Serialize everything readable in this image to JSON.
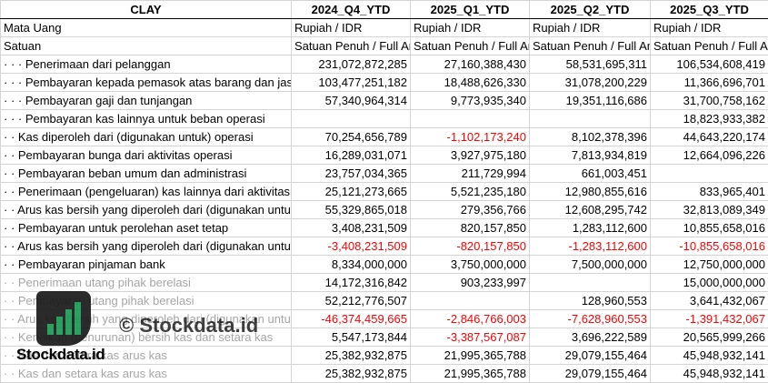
{
  "header": {
    "ticker": "CLAY",
    "periods": [
      "2024_Q4_YTD",
      "2025_Q1_YTD",
      "2025_Q2_YTD",
      "2025_Q3_YTD"
    ]
  },
  "rows": [
    {
      "label": "Mata Uang",
      "values": [
        "Rupiah / IDR",
        "Rupiah / IDR",
        "Rupiah / IDR",
        "Rupiah / IDR"
      ],
      "kind": "text"
    },
    {
      "label": "Satuan",
      "values": [
        "Satuan Penuh / Full Amount",
        "Satuan Penuh / Full Amount",
        "Satuan Penuh / Full Amount",
        "Satuan Penuh / Full Amount"
      ],
      "kind": "text"
    },
    {
      "label": "· · · Penerimaan dari pelanggan",
      "values": [
        "231,072,872,285",
        "27,160,388,430",
        "58,531,695,311",
        "106,534,608,419"
      ]
    },
    {
      "label": "· · · Pembayaran kepada pemasok atas barang dan jasa",
      "values": [
        "103,477,251,182",
        "18,488,626,330",
        "31,078,200,229",
        "11,366,696,701"
      ]
    },
    {
      "label": "· · · Pembayaran gaji dan tunjangan",
      "values": [
        "57,340,964,314",
        "9,773,935,340",
        "19,351,116,686",
        "31,700,758,162"
      ]
    },
    {
      "label": "· · · Pembayaran kas lainnya untuk beban operasi",
      "values": [
        "",
        "",
        "",
        "18,823,933,382"
      ]
    },
    {
      "label": "· · Kas diperoleh dari (digunakan untuk) operasi",
      "values": [
        "70,254,656,789",
        "-1,102,173,240",
        "8,102,378,396",
        "44,643,220,174"
      ]
    },
    {
      "label": "· · Pembayaran bunga dari aktivitas operasi",
      "values": [
        "16,289,031,071",
        "3,927,975,180",
        "7,813,934,819",
        "12,664,096,226"
      ]
    },
    {
      "label": "· · Pembayaran beban umum dan administrasi",
      "values": [
        "23,757,034,365",
        "211,729,994",
        "661,003,451",
        ""
      ]
    },
    {
      "label": "· · Penerimaan (pengeluaran) kas lainnya dari aktivitas operasi",
      "values": [
        "25,121,273,665",
        "5,521,235,180",
        "12,980,855,616",
        "833,965,401"
      ]
    },
    {
      "label": "· · Arus kas bersih yang diperoleh dari (digunakan untuk) aktivitas operasi",
      "values": [
        "55,329,865,018",
        "279,356,766",
        "12,608,295,742",
        "32,813,089,349"
      ]
    },
    {
      "label": "· · Pembayaran untuk perolehan aset tetap",
      "values": [
        "3,408,231,509",
        "820,157,850",
        "1,283,112,600",
        "10,855,658,016"
      ]
    },
    {
      "label": "· · Arus kas bersih yang diperoleh dari (digunakan untuk) aktivitas investasi",
      "values": [
        "-3,408,231,509",
        "-820,157,850",
        "-1,283,112,600",
        "-10,855,658,016"
      ]
    },
    {
      "label": "· · Pembayaran pinjaman bank",
      "values": [
        "8,334,000,000",
        "3,750,000,000",
        "7,500,000,000",
        "12,750,000,000"
      ]
    },
    {
      "label": "· · Penerimaan utang pihak berelasi",
      "values": [
        "14,172,316,842",
        "903,233,997",
        "",
        "15,000,000,000"
      ],
      "faded": true
    },
    {
      "label": "· · Pembayaran utang pihak berelasi",
      "values": [
        "52,212,776,507",
        "",
        "128,960,553",
        "3,641,432,067"
      ],
      "faded": true
    },
    {
      "label": "· · Arus kas bersih yang diperoleh dari (digunakan untuk) aktivitas pendanaan",
      "values": [
        "-46,374,459,665",
        "-2,846,766,003",
        "-7,628,960,553",
        "-1,391,432,067"
      ],
      "faded": true
    },
    {
      "label": "· · Kenaikan (penurunan) bersih kas dan setara kas",
      "values": [
        "5,547,173,844",
        "-3,387,567,087",
        "3,696,222,589",
        "20,565,999,266"
      ],
      "faded": true
    },
    {
      "label": "· · Kas dan setara kas arus kas",
      "values": [
        "25,382,932,875",
        "21,995,365,788",
        "29,079,155,464",
        "45,948,932,141"
      ],
      "faded": true
    },
    {
      "label": "· · Kas dan setara kas arus kas",
      "values": [
        "25,382,932,875",
        "21,995,365,788",
        "29,079,155,464",
        "45,948,932,141"
      ],
      "faded": true
    }
  ],
  "watermark": {
    "brand": "Stockdata.id",
    "url": "© Stockdata.id",
    "colors": {
      "logo_dark": "#1a1a1a",
      "logo_green": "#1a9a55"
    }
  }
}
